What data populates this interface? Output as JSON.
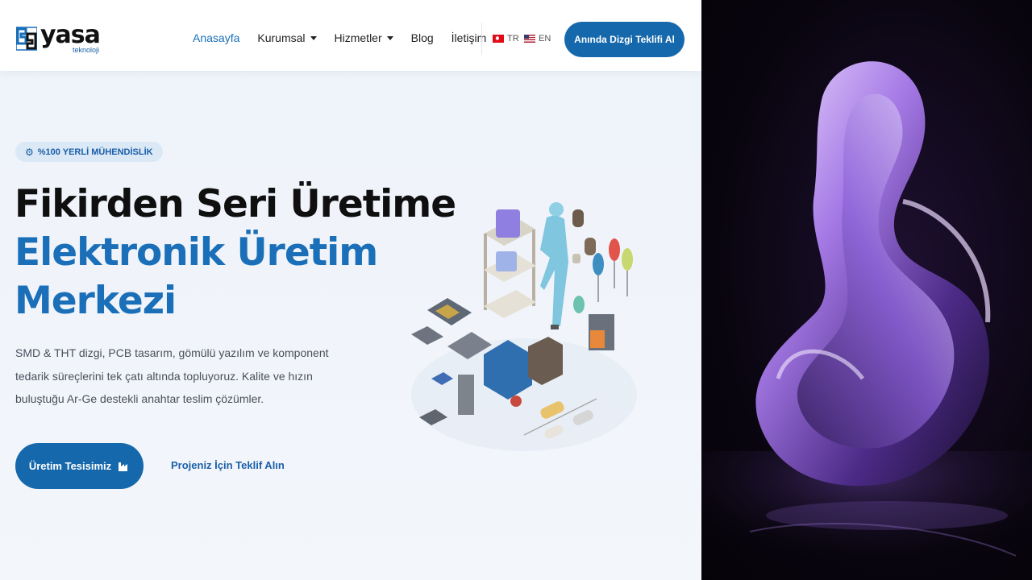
{
  "brand": {
    "name": "yasa",
    "sub": "teknoloji",
    "accent": "#1668ac"
  },
  "nav": {
    "items": [
      {
        "label": "Anasayfa",
        "dropdown": false,
        "active": true
      },
      {
        "label": "Kurumsal",
        "dropdown": true,
        "active": false
      },
      {
        "label": "Hizmetler",
        "dropdown": true,
        "active": false
      },
      {
        "label": "Blog",
        "dropdown": false,
        "active": false
      },
      {
        "label": "İletişim",
        "dropdown": false,
        "active": false
      }
    ],
    "lang_tr": "TR",
    "lang_en": "EN",
    "cta": "Anında Dizgi Teklifi Al"
  },
  "hero": {
    "badge": "%100 YERLİ MÜHENDİSLİK",
    "badge_icon": "gear-icon",
    "title_line1": "Fikirden Seri Üretime",
    "title_line2": "Elektronik Üretim",
    "title_line3": "Merkezi",
    "description": "SMD & THT dizgi, PCB tasarım, gömülü yazılım ve komponent tedarik süreçlerini tek çatı altında topluyoruz. Kalite ve hızın buluştuğu Ar-Ge destekli anahtar teslim çözümler.",
    "primary_button": "Üretim Tesisimiz",
    "primary_icon": "factory-icon",
    "secondary_link": "Projeniz İçin Teklif Alın"
  },
  "colors": {
    "dark_text": "#0f0f0f",
    "blue_text": "#1a6fb8",
    "art_purple": "#8a5cd6"
  }
}
